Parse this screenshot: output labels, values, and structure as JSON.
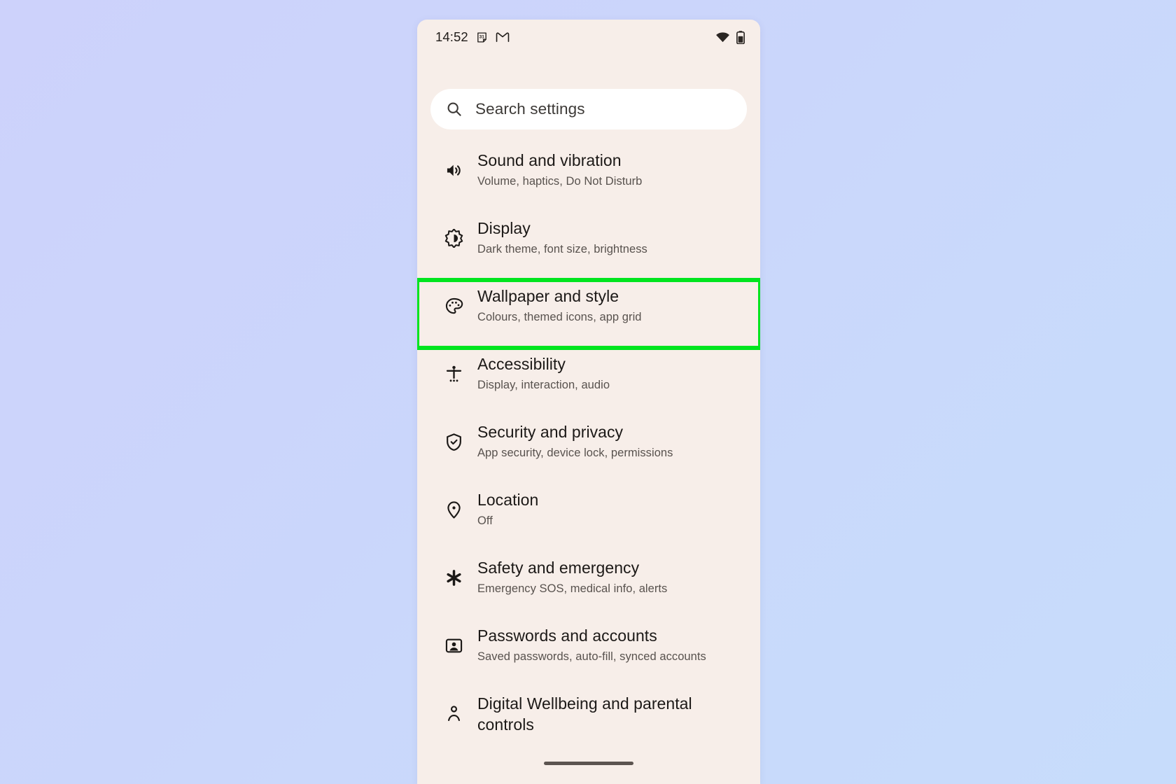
{
  "background": {
    "gradient_from": "#cdd2fb",
    "gradient_to": "#c7dcfb"
  },
  "phone": {
    "screen_bg": "#f7eee9",
    "status_bar": {
      "clock": "14:52",
      "notification_icons": [
        "calendar-31-icon",
        "gmail-icon"
      ],
      "system_icons": [
        "wifi-icon",
        "battery-icon"
      ],
      "calendar_day": "31"
    },
    "search": {
      "placeholder": "Search settings",
      "icon": "search-icon",
      "value": ""
    },
    "highlight": {
      "color": "#00e51f",
      "target_row_index": 2
    },
    "settings": [
      {
        "icon": "volume-up-icon",
        "title": "Sound and vibration",
        "subtitle": "Volume, haptics, Do Not Disturb",
        "highlighted": false
      },
      {
        "icon": "brightness-icon",
        "title": "Display",
        "subtitle": "Dark theme, font size, brightness",
        "highlighted": false
      },
      {
        "icon": "palette-icon",
        "title": "Wallpaper and style",
        "subtitle": "Colours, themed icons, app grid",
        "highlighted": true
      },
      {
        "icon": "accessibility-icon",
        "title": "Accessibility",
        "subtitle": "Display, interaction, audio",
        "highlighted": false
      },
      {
        "icon": "shield-check-icon",
        "title": "Security and privacy",
        "subtitle": "App security, device lock, permissions",
        "highlighted": false
      },
      {
        "icon": "location-pin-icon",
        "title": "Location",
        "subtitle": "Off",
        "highlighted": false
      },
      {
        "icon": "asterisk-emergency-icon",
        "title": "Safety and emergency",
        "subtitle": "Emergency SOS, medical info, alerts",
        "highlighted": false
      },
      {
        "icon": "account-card-icon",
        "title": "Passwords and accounts",
        "subtitle": "Saved passwords, auto-fill, synced accounts",
        "highlighted": false
      },
      {
        "icon": "person-wellbeing-icon",
        "title": "Digital Wellbeing and parental controls",
        "subtitle": "",
        "highlighted": false
      }
    ],
    "gesture_pill": "home-gesture-pill"
  }
}
